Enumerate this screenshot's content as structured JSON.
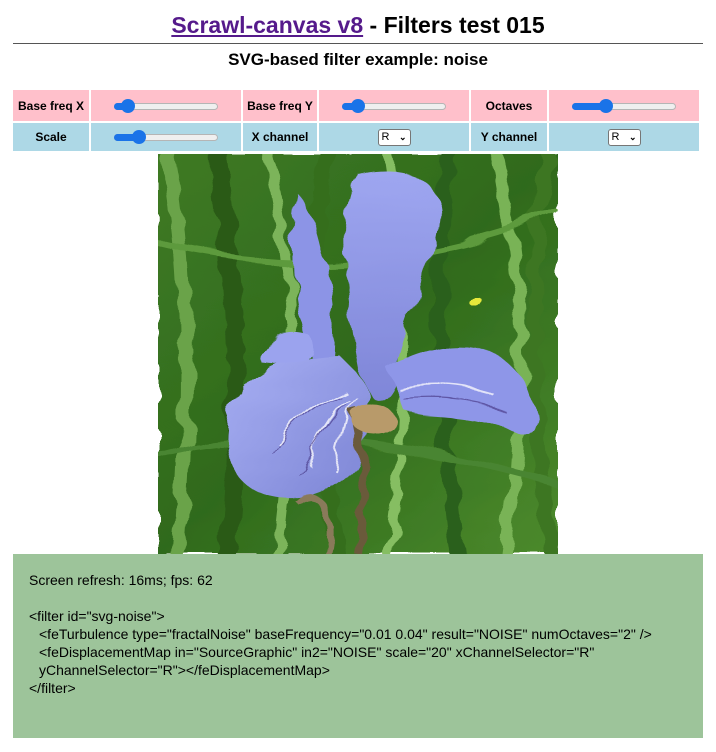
{
  "header": {
    "link_text": "Scrawl-canvas v8",
    "title_suffix": " - Filters test 015",
    "subtitle": "SVG-based filter example: noise"
  },
  "controls": {
    "row1": [
      {
        "label": "Base freq X",
        "slider_value": 0.08
      },
      {
        "label": "Base freq Y",
        "slider_value": 0.1
      },
      {
        "label": "Octaves",
        "slider_value": 0.3
      }
    ],
    "row2": {
      "scale": {
        "label": "Scale",
        "slider_value": 0.2
      },
      "x_channel": {
        "label": "X channel",
        "selected": "R"
      },
      "y_channel": {
        "label": "Y channel",
        "selected": "R"
      }
    }
  },
  "colors": {
    "pink": "#ffc0cb",
    "blue": "#add8e6",
    "slider_accent": "#1a73e8",
    "panel_green": "#9dc49a",
    "link": "#551a8b"
  },
  "canvas": {
    "subject": "iris-flower-image-with-displacement-noise"
  },
  "panel": {
    "refresh": "Screen refresh: 16ms; fps: 62",
    "code_lines": [
      "<filter id=\"svg-noise\">",
      "<feTurbulence type=\"fractalNoise\" baseFrequency=\"0.01 0.04\" result=\"NOISE\" numOctaves=\"2\" />",
      "<feDisplacementMap in=\"SourceGraphic\" in2=\"NOISE\" scale=\"20\" xChannelSelector=\"R\" yChannelSelector=\"R\"></feDisplacementMap>",
      "</filter>"
    ]
  }
}
